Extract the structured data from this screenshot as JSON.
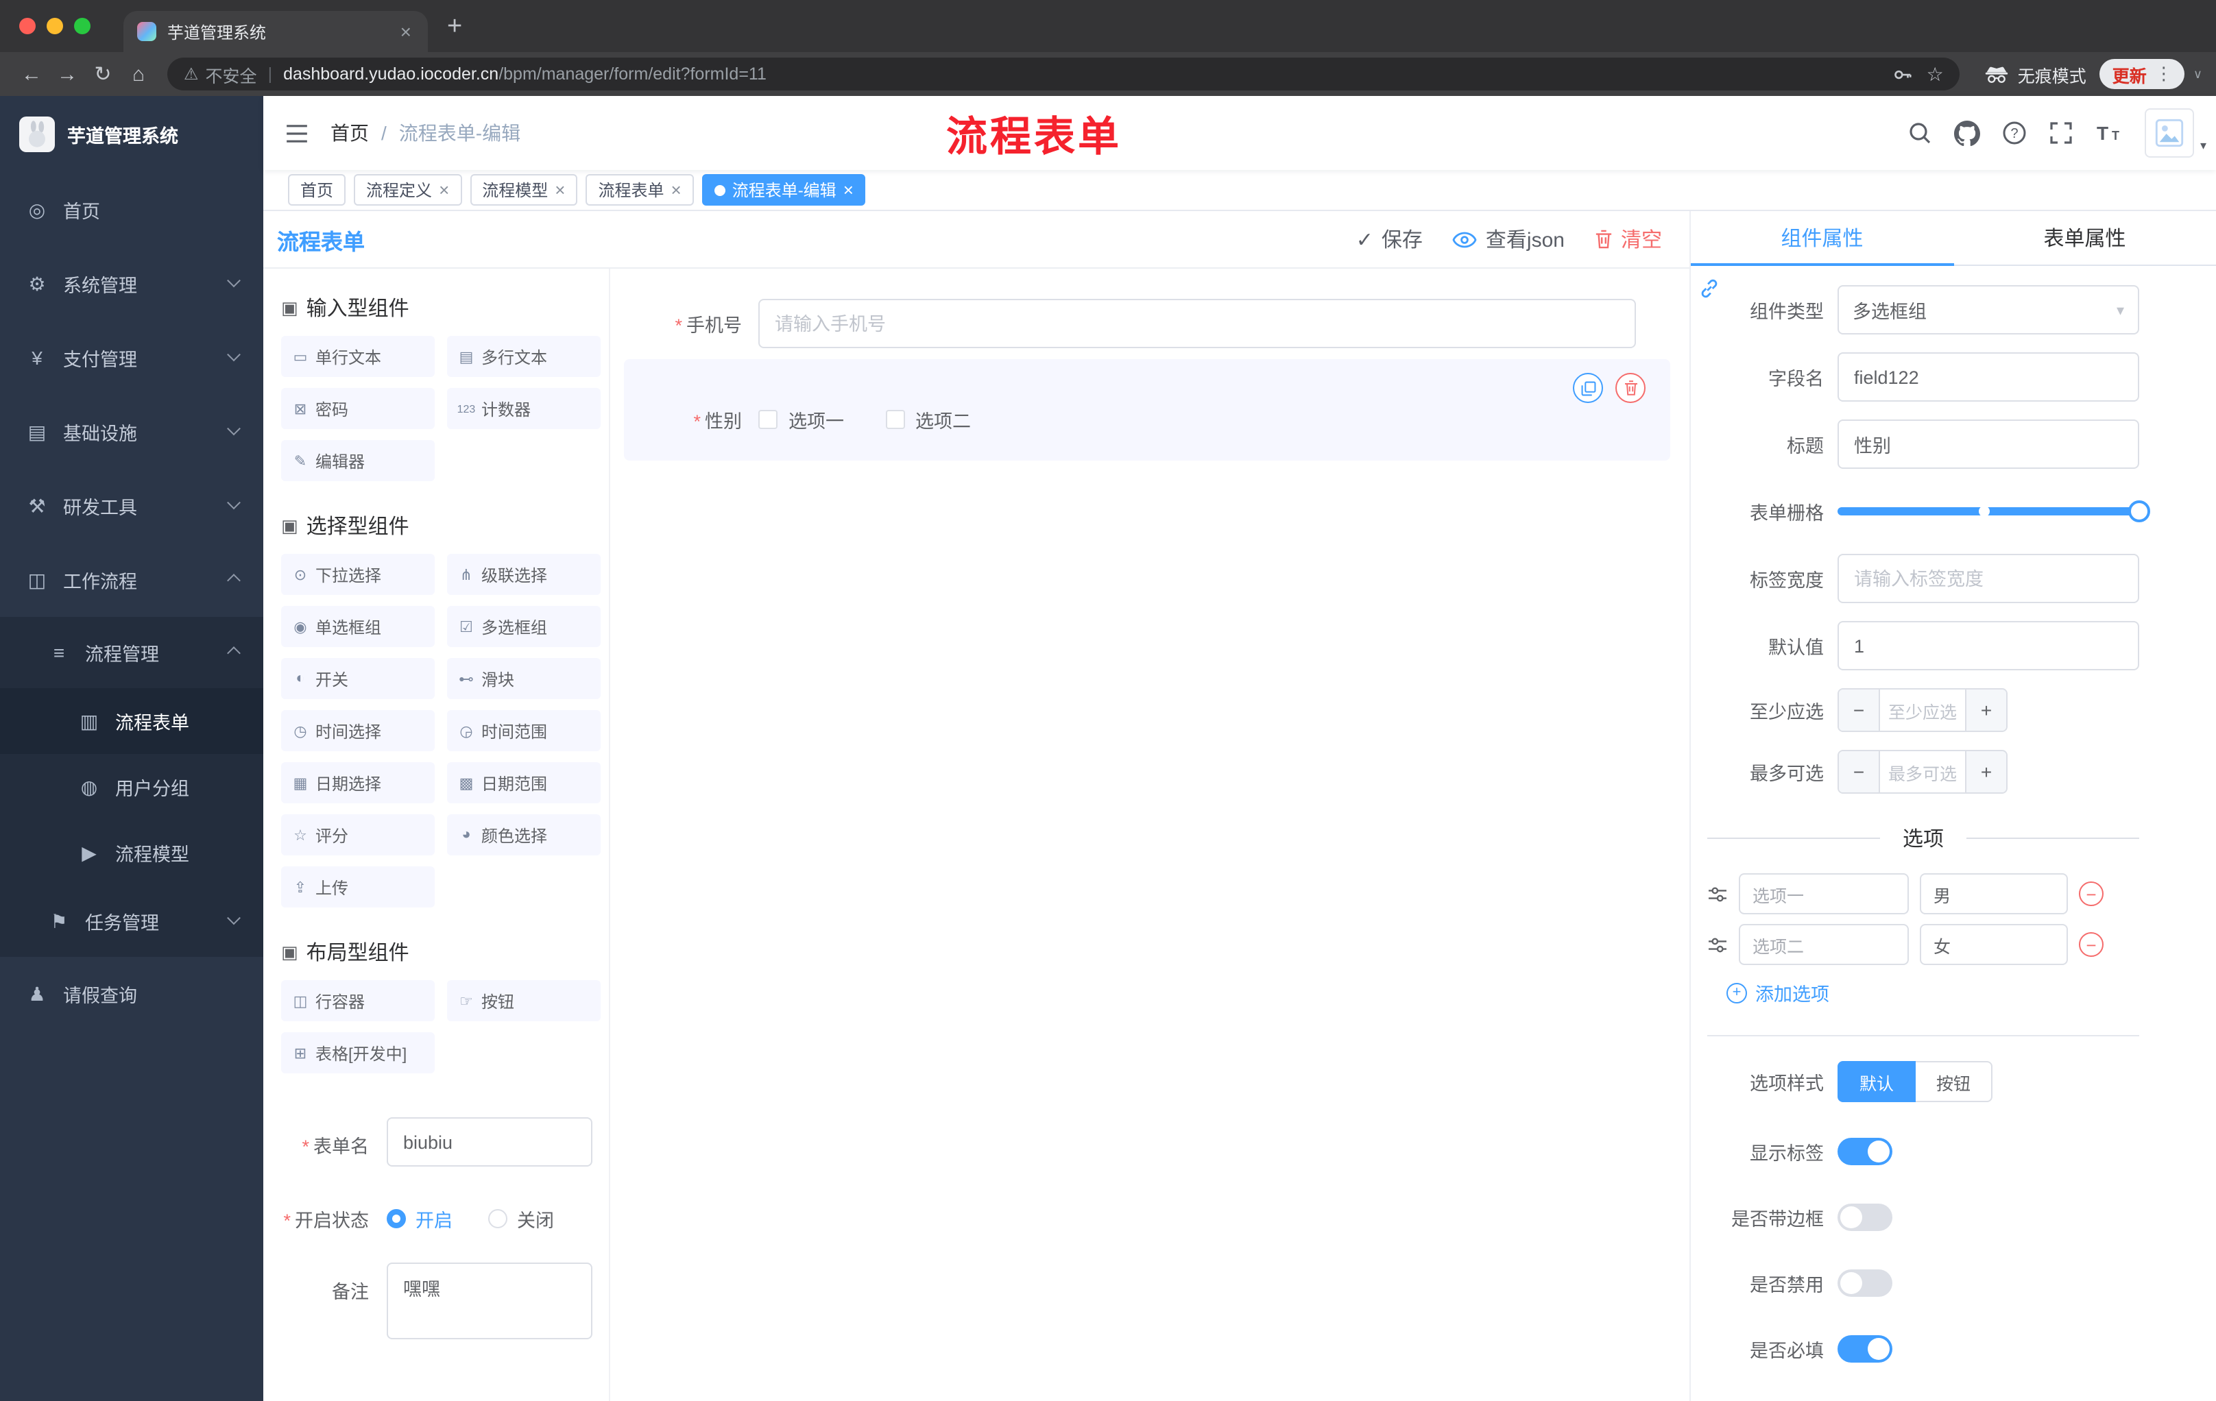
{
  "colors": {
    "accent": "#409eff",
    "danger": "#f56c6c",
    "annotation_red": "#f5222d",
    "update_red": "#d93025",
    "sidebar_bg": "#2b3648",
    "tag_active": "#409eff"
  },
  "browser": {
    "tab_title": "芋道管理系统",
    "security_label": "不安全",
    "url_host": "dashboard.yudao.iocoder.cn",
    "url_path": "/bpm/manager/form/edit?formId=11",
    "incognito_label": "无痕模式",
    "update_label": "更新"
  },
  "sidebar": {
    "logo_title": "芋道管理系统",
    "items": [
      {
        "icon": "◎",
        "label": "首页"
      },
      {
        "icon": "⚙",
        "label": "系统管理"
      },
      {
        "icon": "¥",
        "label": "支付管理"
      },
      {
        "icon": "▤",
        "label": "基础设施"
      },
      {
        "icon": "⚒",
        "label": "研发工具"
      },
      {
        "icon": "◫",
        "label": "工作流程"
      },
      {
        "icon": "≡",
        "label": "流程管理"
      },
      {
        "icon": "▥",
        "label": "流程表单"
      },
      {
        "icon": "◍",
        "label": "用户分组"
      },
      {
        "icon": "▶",
        "label": "流程模型"
      },
      {
        "icon": "⚑",
        "label": "任务管理"
      },
      {
        "icon": "♟",
        "label": "请假查询"
      }
    ]
  },
  "header": {
    "breadcrumb_home": "首页",
    "breadcrumb_current": "流程表单-编辑",
    "annotation": "流程表单"
  },
  "tags": [
    {
      "label": "首页"
    },
    {
      "label": "流程定义"
    },
    {
      "label": "流程模型"
    },
    {
      "label": "流程表单"
    },
    {
      "label": "流程表单-编辑"
    }
  ],
  "designer": {
    "title": "流程表单",
    "save": "保存",
    "view_json": "查看json",
    "clear": "清空"
  },
  "palette": {
    "groups": [
      {
        "icon": "▣",
        "title": "输入型组件",
        "items": [
          {
            "icon": "▭",
            "label": "单行文本"
          },
          {
            "icon": "▤",
            "label": "多行文本"
          },
          {
            "icon": "⊠",
            "label": "密码"
          },
          {
            "icon": "123",
            "label": "计数器"
          },
          {
            "icon": "✎",
            "label": "编辑器"
          }
        ]
      },
      {
        "icon": "▣",
        "title": "选择型组件",
        "items": [
          {
            "icon": "⊙",
            "label": "下拉选择"
          },
          {
            "icon": "⋔",
            "label": "级联选择"
          },
          {
            "icon": "◉",
            "label": "单选框组"
          },
          {
            "icon": "☑",
            "label": "多选框组"
          },
          {
            "icon": "◐",
            "label": "开关"
          },
          {
            "icon": "⊷",
            "label": "滑块"
          },
          {
            "icon": "◷",
            "label": "时间选择"
          },
          {
            "icon": "◶",
            "label": "时间范围"
          },
          {
            "icon": "▦",
            "label": "日期选择"
          },
          {
            "icon": "▩",
            "label": "日期范围"
          },
          {
            "icon": "☆",
            "label": "评分"
          },
          {
            "icon": "◕",
            "label": "颜色选择"
          },
          {
            "icon": "⇪",
            "label": "上传"
          }
        ]
      },
      {
        "icon": "▣",
        "title": "布局型组件",
        "items": [
          {
            "icon": "◫",
            "label": "行容器"
          },
          {
            "icon": "☞",
            "label": "按钮"
          },
          {
            "icon": "⊞",
            "label": "表格[开发中]"
          }
        ]
      }
    ]
  },
  "form_meta": {
    "name_label": "表单名",
    "name_value": "biubiu",
    "status_label": "开启状态",
    "status_on": "开启",
    "status_off": "关闭",
    "remark_label": "备注",
    "remark_value": "嘿嘿"
  },
  "canvas": {
    "phone_label": "手机号",
    "phone_placeholder": "请输入手机号",
    "gender_label": "性别",
    "gender_opt1": "选项一",
    "gender_opt2": "选项二"
  },
  "panel": {
    "tabs": [
      "组件属性",
      "表单属性"
    ],
    "component_type_label": "组件类型",
    "component_type_value": "多选框组",
    "field_name_label": "字段名",
    "field_name_value": "field122",
    "title_label": "标题",
    "title_value": "性别",
    "grid_label": "表单栅格",
    "label_width_label": "标签宽度",
    "label_width_placeholder": "请输入标签宽度",
    "default_label": "默认值",
    "default_value": "1",
    "min_label": "至少应选",
    "min_placeholder": "至少应选",
    "max_label": "最多可选",
    "max_placeholder": "最多可选",
    "options_divider": "选项",
    "options": [
      {
        "label": "选项一",
        "value": "男"
      },
      {
        "label": "选项二",
        "value": "女"
      }
    ],
    "add_option": "添加选项",
    "style_label": "选项样式",
    "style_default": "默认",
    "style_button": "按钮",
    "switches": [
      {
        "label": "显示标签",
        "on": true
      },
      {
        "label": "是否带边框",
        "on": false
      },
      {
        "label": "是否禁用",
        "on": false
      },
      {
        "label": "是否必填",
        "on": true
      }
    ]
  }
}
